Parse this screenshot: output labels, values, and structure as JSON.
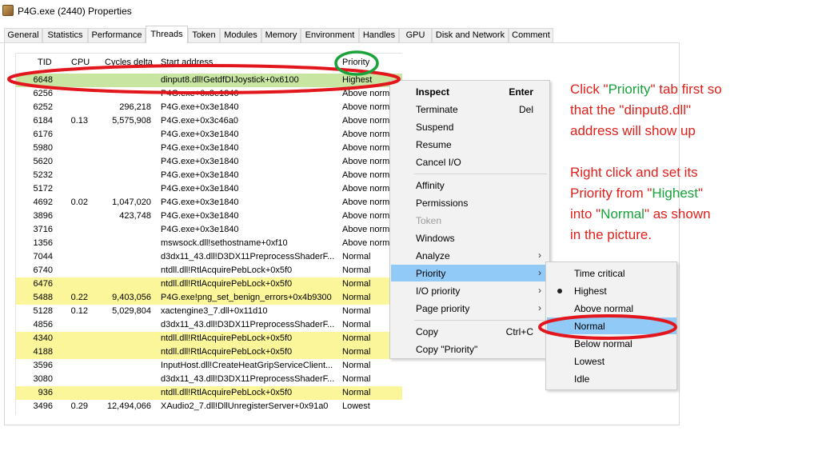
{
  "window": {
    "title": "P4G.exe (2440) Properties",
    "icon": "app-icon"
  },
  "tabs": [
    {
      "label": "General"
    },
    {
      "label": "Statistics"
    },
    {
      "label": "Performance"
    },
    {
      "label": "Threads",
      "active": true
    },
    {
      "label": "Token"
    },
    {
      "label": "Modules"
    },
    {
      "label": "Memory"
    },
    {
      "label": "Environment"
    },
    {
      "label": "Handles"
    },
    {
      "label": "GPU"
    },
    {
      "label": "Disk and Network"
    },
    {
      "label": "Comment"
    }
  ],
  "columns": {
    "tid": "TID",
    "cpu": "CPU",
    "cycles": "Cycles delta",
    "address": "Start address",
    "priority": "Priority"
  },
  "rows": [
    {
      "tid": "6648",
      "cpu": "",
      "cycles": "",
      "address": "dinput8.dll!GetdfDIJoystick+0x6100",
      "priority": "Highest",
      "state": "selected"
    },
    {
      "tid": "6256",
      "cpu": "",
      "cycles": "",
      "address": "P4G.exe+0x3e1840",
      "priority": "Above norm",
      "state": ""
    },
    {
      "tid": "6252",
      "cpu": "",
      "cycles": "296,218",
      "address": "P4G.exe+0x3e1840",
      "priority": "Above norm",
      "state": ""
    },
    {
      "tid": "6184",
      "cpu": "0.13",
      "cycles": "5,575,908",
      "address": "P4G.exe+0x3c46a0",
      "priority": "Above norm",
      "state": ""
    },
    {
      "tid": "6176",
      "cpu": "",
      "cycles": "",
      "address": "P4G.exe+0x3e1840",
      "priority": "Above norm",
      "state": ""
    },
    {
      "tid": "5980",
      "cpu": "",
      "cycles": "",
      "address": "P4G.exe+0x3e1840",
      "priority": "Above norm",
      "state": ""
    },
    {
      "tid": "5620",
      "cpu": "",
      "cycles": "",
      "address": "P4G.exe+0x3e1840",
      "priority": "Above norm",
      "state": ""
    },
    {
      "tid": "5232",
      "cpu": "",
      "cycles": "",
      "address": "P4G.exe+0x3e1840",
      "priority": "Above norm",
      "state": ""
    },
    {
      "tid": "5172",
      "cpu": "",
      "cycles": "",
      "address": "P4G.exe+0x3e1840",
      "priority": "Above norm",
      "state": ""
    },
    {
      "tid": "4692",
      "cpu": "0.02",
      "cycles": "1,047,020",
      "address": "P4G.exe+0x3e1840",
      "priority": "Above norm",
      "state": ""
    },
    {
      "tid": "3896",
      "cpu": "",
      "cycles": "423,748",
      "address": "P4G.exe+0x3e1840",
      "priority": "Above norm",
      "state": ""
    },
    {
      "tid": "3716",
      "cpu": "",
      "cycles": "",
      "address": "P4G.exe+0x3e1840",
      "priority": "Above norm",
      "state": ""
    },
    {
      "tid": "1356",
      "cpu": "",
      "cycles": "",
      "address": "mswsock.dll!sethostname+0xf10",
      "priority": "Above norm",
      "state": ""
    },
    {
      "tid": "7044",
      "cpu": "",
      "cycles": "",
      "address": "d3dx11_43.dll!D3DX11PreprocessShaderF...",
      "priority": "Normal",
      "state": ""
    },
    {
      "tid": "6740",
      "cpu": "",
      "cycles": "",
      "address": "ntdll.dll!RtlAcquirePebLock+0x5f0",
      "priority": "Normal",
      "state": ""
    },
    {
      "tid": "6476",
      "cpu": "",
      "cycles": "",
      "address": "ntdll.dll!RtlAcquirePebLock+0x5f0",
      "priority": "Normal",
      "state": "hl"
    },
    {
      "tid": "5488",
      "cpu": "0.22",
      "cycles": "9,403,056",
      "address": "P4G.exe!png_set_benign_errors+0x4b9300",
      "priority": "Normal",
      "state": "hl"
    },
    {
      "tid": "5128",
      "cpu": "0.12",
      "cycles": "5,029,804",
      "address": "xactengine3_7.dll+0x11d10",
      "priority": "Normal",
      "state": ""
    },
    {
      "tid": "4856",
      "cpu": "",
      "cycles": "",
      "address": "d3dx11_43.dll!D3DX11PreprocessShaderF...",
      "priority": "Normal",
      "state": ""
    },
    {
      "tid": "4340",
      "cpu": "",
      "cycles": "",
      "address": "ntdll.dll!RtlAcquirePebLock+0x5f0",
      "priority": "Normal",
      "state": "hl"
    },
    {
      "tid": "4188",
      "cpu": "",
      "cycles": "",
      "address": "ntdll.dll!RtlAcquirePebLock+0x5f0",
      "priority": "Normal",
      "state": "hl"
    },
    {
      "tid": "3596",
      "cpu": "",
      "cycles": "",
      "address": "InputHost.dll!CreateHeatGripServiceClient...",
      "priority": "Normal",
      "state": ""
    },
    {
      "tid": "3080",
      "cpu": "",
      "cycles": "",
      "address": "d3dx11_43.dll!D3DX11PreprocessShaderF...",
      "priority": "Normal",
      "state": ""
    },
    {
      "tid": "936",
      "cpu": "",
      "cycles": "",
      "address": "ntdll.dll!RtlAcquirePebLock+0x5f0",
      "priority": "Normal",
      "state": "hl"
    },
    {
      "tid": "3496",
      "cpu": "0.29",
      "cycles": "12,494,066",
      "address": "XAudio2_7.dll!DllUnregisterServer+0x91a0",
      "priority": "Lowest",
      "state": ""
    }
  ],
  "context_menu": {
    "inspect": "Inspect",
    "inspect_shortcut": "Enter",
    "terminate": "Terminate",
    "terminate_shortcut": "Del",
    "suspend": "Suspend",
    "resume": "Resume",
    "cancel_io": "Cancel I/O",
    "affinity": "Affinity",
    "permissions": "Permissions",
    "token": "Token",
    "windows": "Windows",
    "analyze": "Analyze",
    "priority": "Priority",
    "io_priority": "I/O priority",
    "page_priority": "Page priority",
    "copy": "Copy",
    "copy_shortcut": "Ctrl+C",
    "copy_priority": "Copy \"Priority\""
  },
  "priority_submenu": {
    "items": [
      "Time critical",
      "Highest",
      "Above normal",
      "Normal",
      "Below normal",
      "Lowest",
      "Idle"
    ],
    "checked": "Highest",
    "hovered": "Normal"
  },
  "annotations": {
    "line1_a": "Click \"",
    "line1_b": "Priority",
    "line1_c": "\" tab first so",
    "line2": "that the \"dinput8.dll\"",
    "line3": "address will show up",
    "line4": "Right click and set its",
    "line5_a": "Priority from \"",
    "line5_b": "Highest",
    "line5_c": "\"",
    "line6_a": "into \"",
    "line6_b": "Normal",
    "line6_c": "\" as shown",
    "line7": "in the picture."
  },
  "colors": {
    "selected_row": "#c8e6a2",
    "highlight_row": "#fbf69a",
    "menu_hover": "#91c9f7",
    "annotation_red": "#e0201b",
    "annotation_green": "#17a33a",
    "ellipse_red": "#e3161d",
    "ellipse_green": "#1aa33a"
  }
}
